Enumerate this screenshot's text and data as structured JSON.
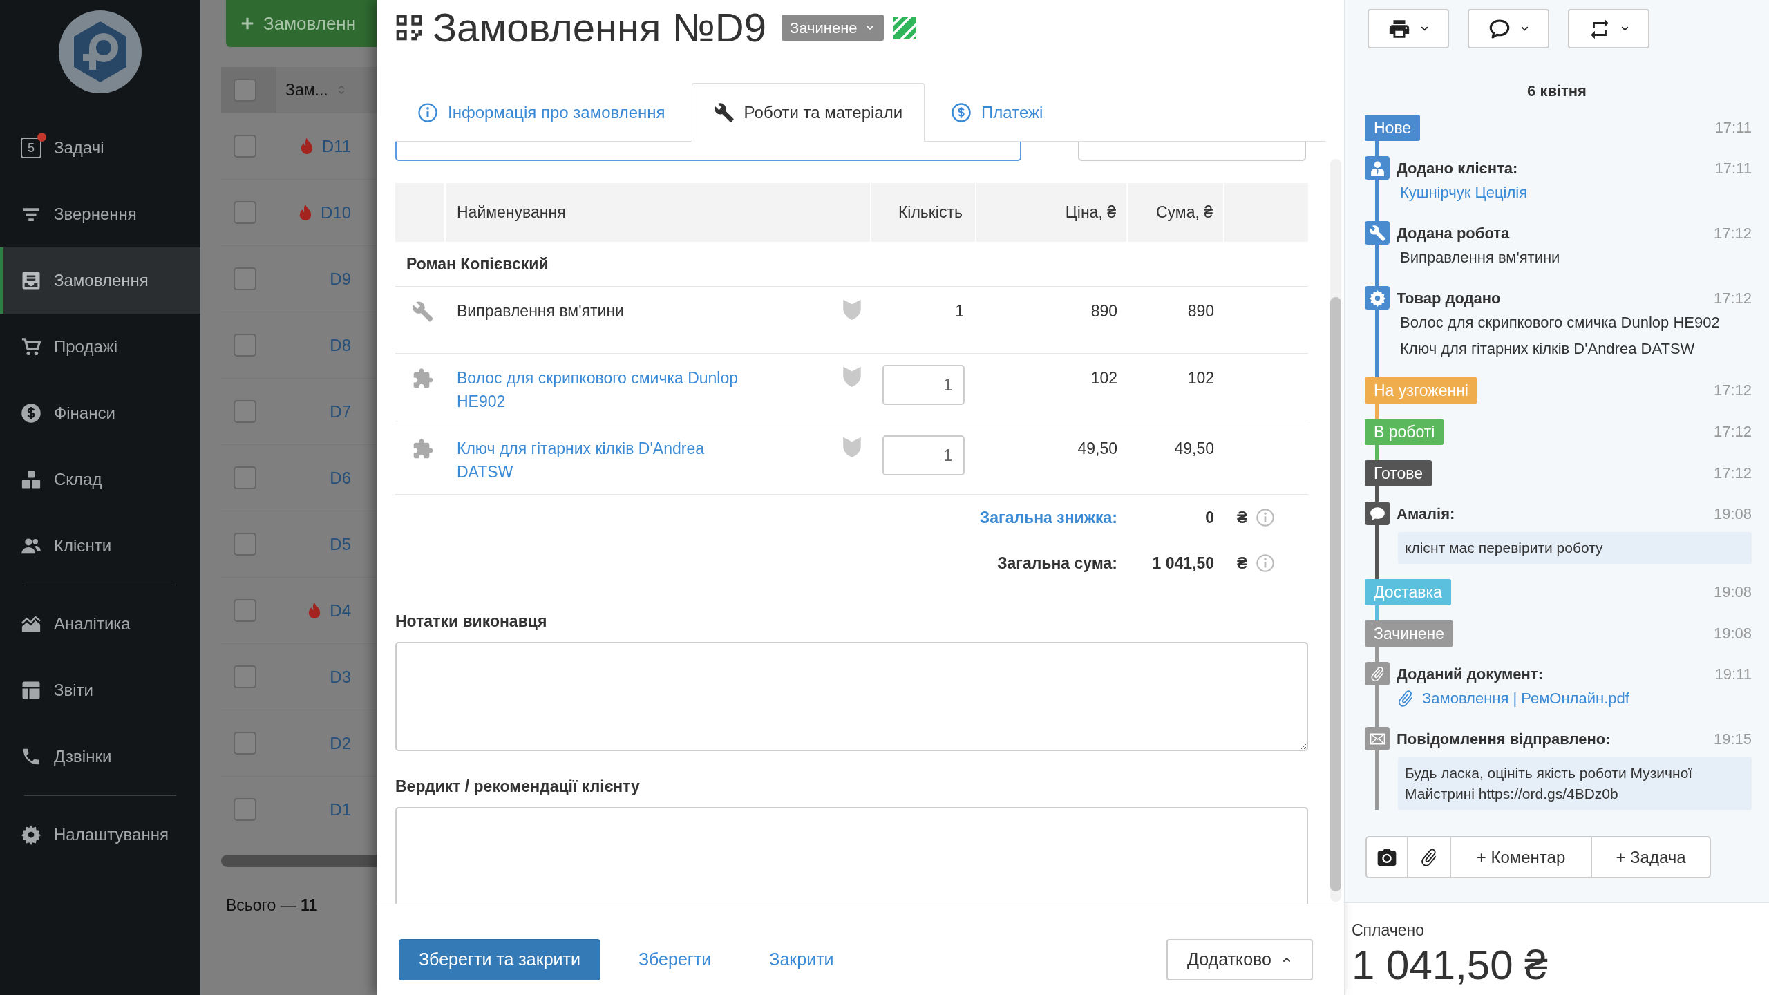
{
  "sidebar": {
    "groups": [
      [
        {
          "kind": "tasks",
          "label": "Задачі",
          "count": "5",
          "alert": true,
          "selected": false
        },
        {
          "kind": "requests",
          "label": "Звернення",
          "alert": false,
          "selected": false
        },
        {
          "kind": "orders",
          "label": "Замовлення",
          "alert": false,
          "selected": true
        },
        {
          "kind": "sales",
          "label": "Продажі",
          "alert": false,
          "selected": false
        },
        {
          "kind": "finance",
          "label": "Фінанси",
          "alert": false,
          "selected": false
        },
        {
          "kind": "warehouse",
          "label": "Склад",
          "alert": false,
          "selected": false
        },
        {
          "kind": "clients",
          "label": "Клієнти",
          "alert": false,
          "selected": false
        }
      ],
      [
        {
          "kind": "analytics",
          "label": "Аналітика",
          "alert": false,
          "selected": false
        },
        {
          "kind": "reports",
          "label": "Звіти",
          "alert": false,
          "selected": false
        },
        {
          "kind": "calls",
          "label": "Дзвінки",
          "alert": false,
          "selected": false
        }
      ],
      [
        {
          "kind": "settings",
          "label": "Налаштування",
          "alert": false,
          "selected": false
        }
      ]
    ]
  },
  "orders_list": {
    "new_button": "Замовленн",
    "column": "Зам...",
    "all_checked": false,
    "rows": [
      {
        "number": "D11",
        "urgent": true,
        "checked": false
      },
      {
        "number": "D10",
        "urgent": true,
        "checked": false
      },
      {
        "number": "D9",
        "urgent": false,
        "checked": false
      },
      {
        "number": "D8",
        "urgent": false,
        "checked": false
      },
      {
        "number": "D7",
        "urgent": false,
        "checked": false
      },
      {
        "number": "D6",
        "urgent": false,
        "checked": false
      },
      {
        "number": "D5",
        "urgent": false,
        "checked": false
      },
      {
        "number": "D4",
        "urgent": true,
        "checked": false
      },
      {
        "number": "D3",
        "urgent": false,
        "checked": false
      },
      {
        "number": "D2",
        "urgent": false,
        "checked": false
      },
      {
        "number": "D1",
        "urgent": false,
        "checked": false
      }
    ],
    "total": "Всього — **11**"
  },
  "order": {
    "title": "Замовлення №D9",
    "status": "Зачинене",
    "tabs": [
      {
        "kind": "info",
        "label": "Інформація про замовлення",
        "selected": false
      },
      {
        "kind": "works",
        "label": "Роботи та матеріали",
        "selected": true
      },
      {
        "kind": "payments",
        "label": "Платежі",
        "selected": false
      }
    ],
    "table": {
      "columns": [
        "Найменування",
        "Кількість",
        "Ціна, ₴",
        "Сума, ₴"
      ],
      "groups": [
        {
          "name": "Роман Копієвский",
          "rows": [
            {
              "kind": "work",
              "name": "Виправлення вм'ятини",
              "quantity": "1",
              "price": "890",
              "sum": "890"
            },
            {
              "kind": "product",
              "name": "Волос для скрипкового смичка Dunlop HE902",
              "quantity": "1",
              "price": "102",
              "sum": "102"
            },
            {
              "kind": "product",
              "name": "Ключ для гітарних кілків D'Andrea DATSW",
              "quantity": "1",
              "price": "49,50",
              "sum": "49,50"
            }
          ]
        }
      ]
    },
    "totals": [
      {
        "kind": "link",
        "label": "Загальна знижка:",
        "value": "0",
        "currency": "₴"
      },
      {
        "kind": "plain",
        "label": "Загальна сума:",
        "value": "1 041,50",
        "currency": "₴"
      }
    ],
    "notes": [
      {
        "label": "Нотатки виконавця"
      },
      {
        "label": "Вердикт / рекомендації клієнту"
      }
    ],
    "footer": {
      "buttons": [
        {
          "kind": "primary",
          "label": "Зберегти та закрити"
        },
        {
          "kind": "link",
          "label": "Зберегти"
        },
        {
          "kind": "link",
          "label": "Закрити"
        }
      ],
      "more": "Додатково"
    }
  },
  "history": {
    "date": "6 квітня",
    "entries": [
      {
        "kind": "status",
        "label": "Нове",
        "color": "#4a8bd0",
        "time": "17:11"
      },
      {
        "kind": "client",
        "title": "Додано клієнта:",
        "color": "#4a8bd0",
        "time": "17:11",
        "link": "Кушнірчук Цецілія"
      },
      {
        "kind": "work",
        "title": "Додана робота",
        "color": "#4a8bd0",
        "time": "17:12",
        "lines": [
          "Виправлення вм'ятини"
        ]
      },
      {
        "kind": "product",
        "title": "Товар додано",
        "color": "#4a8bd0",
        "time": "17:12",
        "lines": [
          "Волос для скрипкового смичка Dunlop HE902",
          "Ключ для гітарних кілків D'Andrea DATSW"
        ]
      },
      {
        "kind": "status",
        "label": "На узгоженні",
        "color": "#f0ad4e",
        "time": "17:12"
      },
      {
        "kind": "status",
        "label": "В роботі",
        "color": "#5cb85c",
        "time": "17:12"
      },
      {
        "kind": "status",
        "label": "Готове",
        "color": "#555555",
        "time": "17:12"
      },
      {
        "kind": "comment",
        "title": "Амалія:",
        "color": "#555555",
        "time": "19:08",
        "note": "клієнт має перевірити роботу"
      },
      {
        "kind": "status",
        "label": "Доставка",
        "color": "#5bc0de",
        "time": "19:08"
      },
      {
        "kind": "status",
        "label": "Зачинене",
        "color": "#999999",
        "time": "19:08"
      },
      {
        "kind": "document",
        "title": "Доданий документ:",
        "color": "#999999",
        "time": "19:11",
        "file": "Замовлення | РемОнлайн.pdf"
      },
      {
        "kind": "message",
        "title": "Повідомлення відправлено:",
        "color": "#999999",
        "time": "19:15",
        "note": "Будь ласка, оцініть якість роботи Музичної Майстрині https://ord.gs/4BDz0b"
      }
    ],
    "actions": [
      "+ Коментар",
      "+ Задача"
    ]
  },
  "payment": {
    "label": "Сплачено",
    "amount": "1 041,50 ₴"
  }
}
